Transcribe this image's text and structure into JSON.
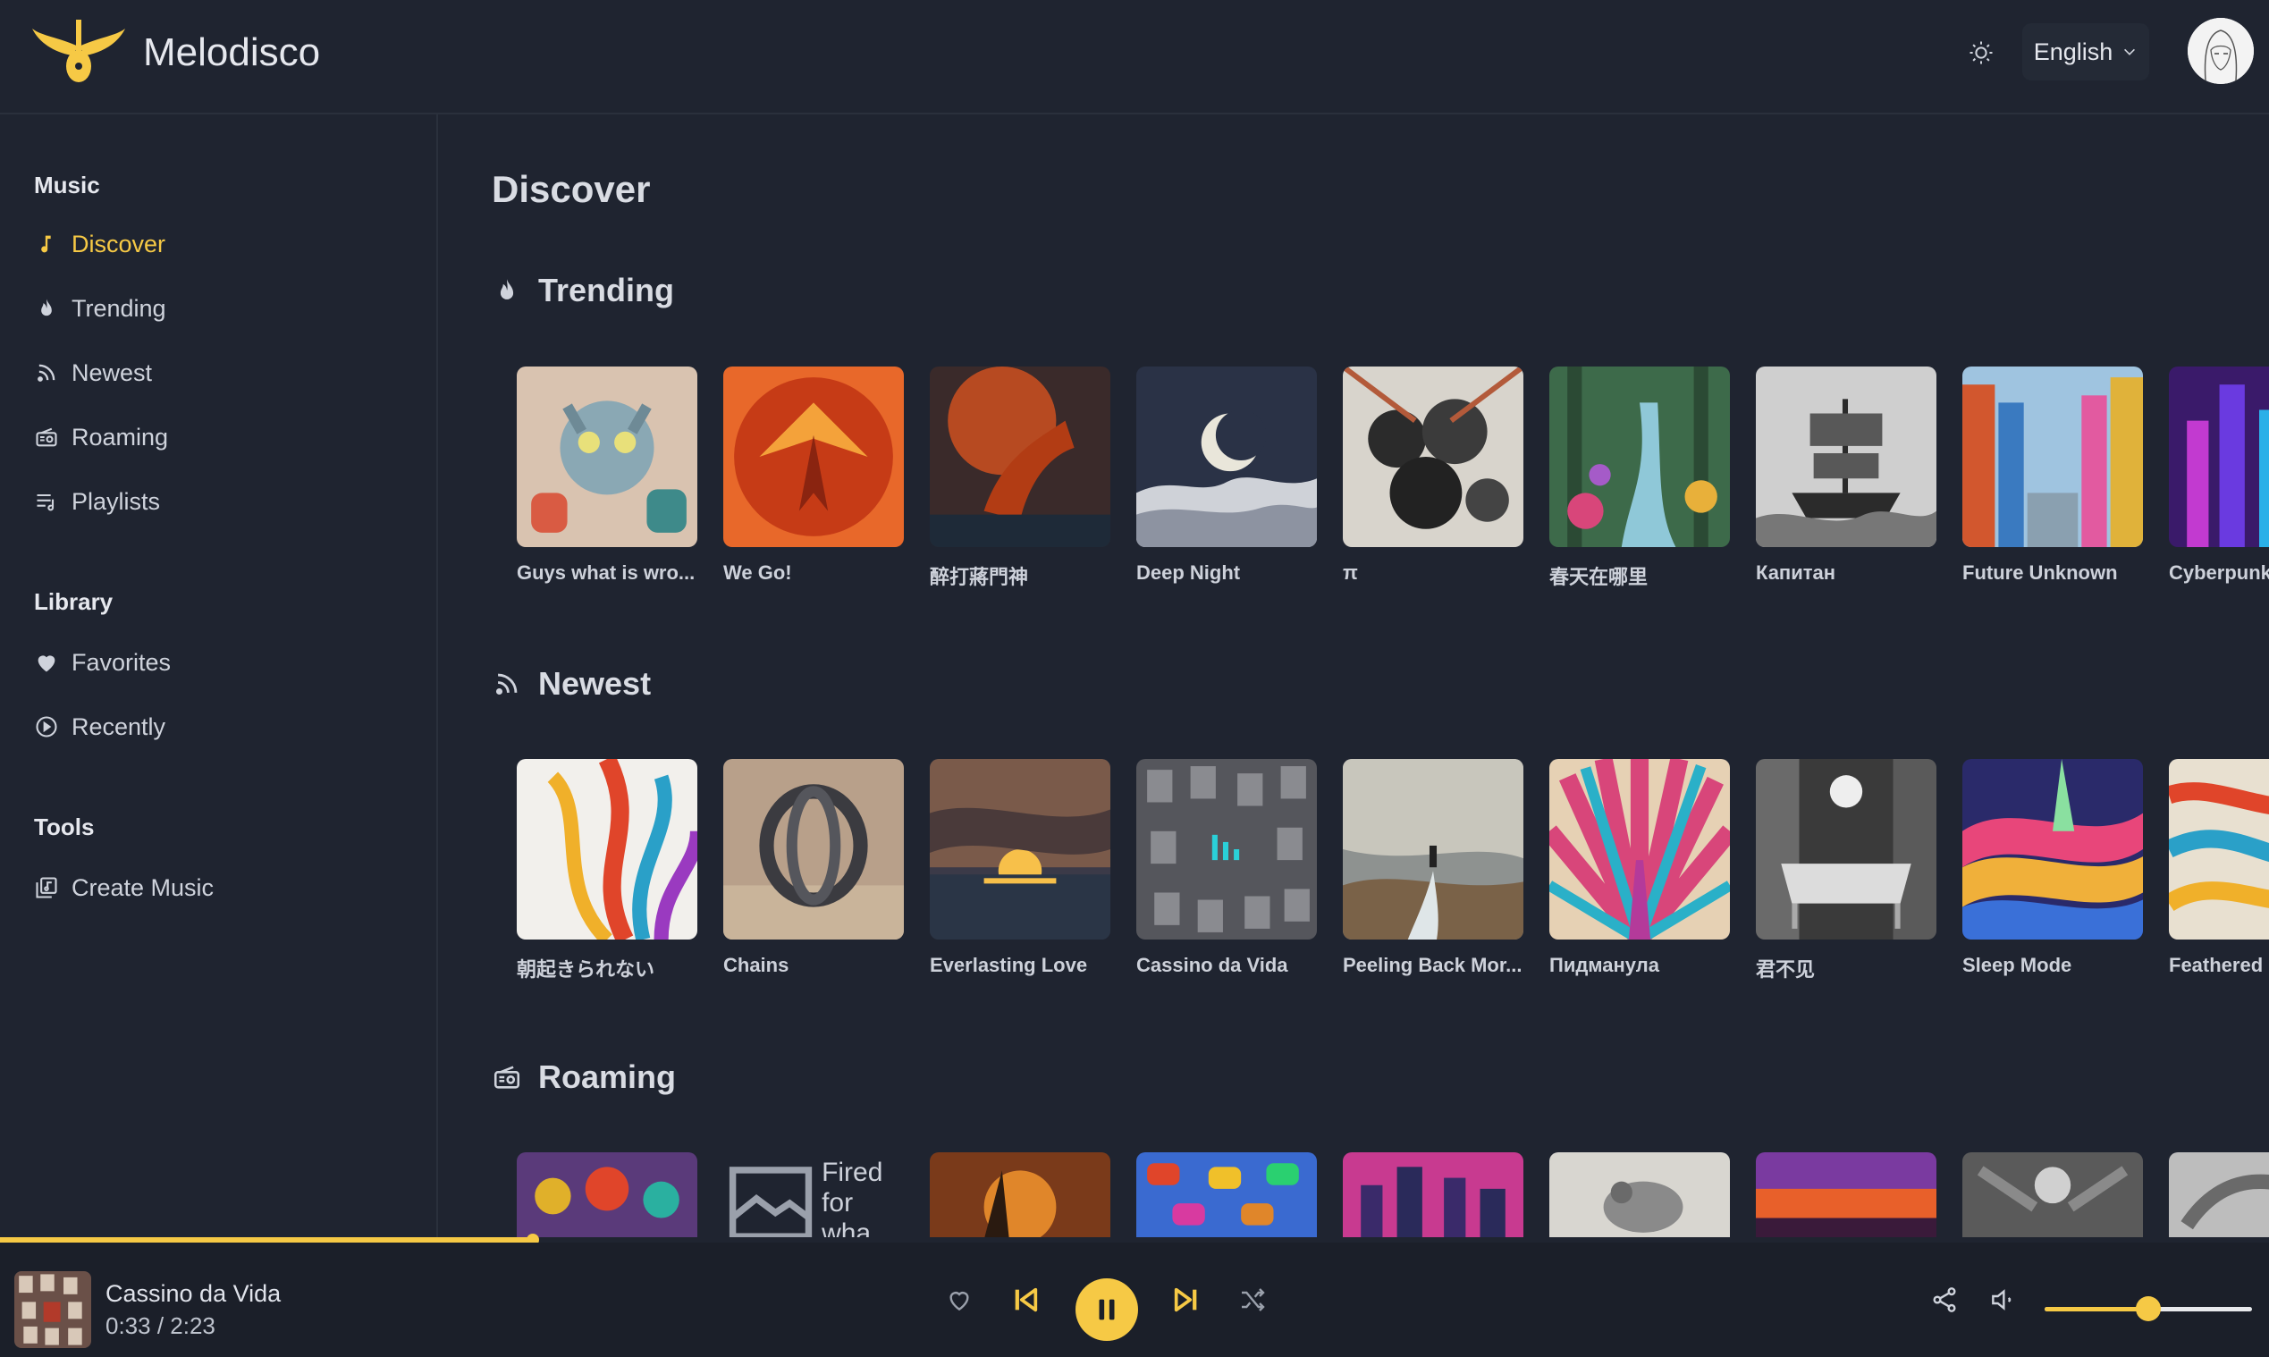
{
  "app": {
    "title": "Melodisco"
  },
  "header": {
    "language": "English"
  },
  "sidebar": {
    "music_title": "Music",
    "music_items": [
      {
        "label": "Discover",
        "icon": "music-note-icon"
      },
      {
        "label": "Trending",
        "icon": "flame-icon"
      },
      {
        "label": "Newest",
        "icon": "rss-icon"
      },
      {
        "label": "Roaming",
        "icon": "radio-icon"
      },
      {
        "label": "Playlists",
        "icon": "playlist-icon"
      }
    ],
    "library_title": "Library",
    "library_items": [
      {
        "label": "Favorites",
        "icon": "heart-icon"
      },
      {
        "label": "Recently",
        "icon": "play-circle-icon"
      }
    ],
    "tools_title": "Tools",
    "tools_items": [
      {
        "label": "Create Music",
        "icon": "create-music-icon"
      }
    ]
  },
  "main": {
    "page_title": "Discover",
    "trending": {
      "title": "Trending",
      "items": [
        "Guys what is wro...",
        "We Go!",
        "醉打蔣門神",
        "Deep Night",
        "π",
        "春天在哪里",
        "Капитан",
        "Future Unknown",
        "Cyberpunk"
      ]
    },
    "newest": {
      "title": "Newest",
      "items": [
        "朝起きられない",
        "Chains",
        "Everlasting Love",
        "Cassino da Vida",
        "Peeling Back Mor...",
        "Пидманула",
        "君不见",
        "Sleep Mode",
        "Feathered"
      ]
    },
    "roaming": {
      "title": "Roaming",
      "broken_image_alt": "Fired for wha"
    }
  },
  "player": {
    "title": "Cassino da Vida",
    "time": "0:33 / 2:23",
    "progress": 0.235,
    "volume": 0.5
  },
  "colors": {
    "accent": "#f6c945",
    "background": "#1f2430"
  }
}
